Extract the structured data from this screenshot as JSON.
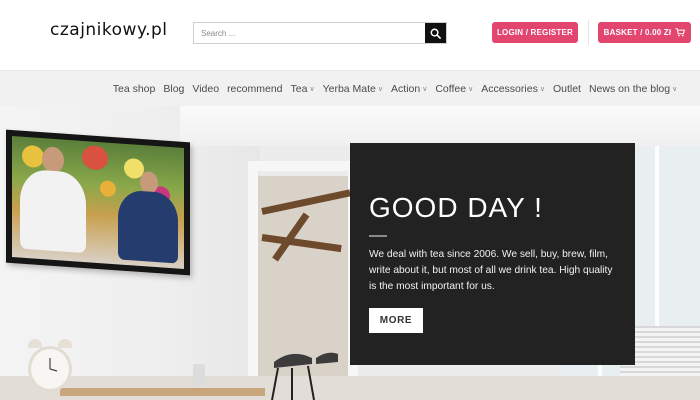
{
  "header": {
    "logo_text": "czajnikowy.pl",
    "search": {
      "placeholder": "Search ..."
    },
    "login_label": "LOGIN / REGISTER",
    "basket_label": "BASKET / 0.00 Zł"
  },
  "nav": {
    "items": [
      {
        "label": "Tea shop",
        "has_dropdown": false
      },
      {
        "label": "Blog",
        "has_dropdown": false
      },
      {
        "label": "Video",
        "has_dropdown": false
      },
      {
        "label": "recommend",
        "has_dropdown": false
      },
      {
        "label": "Tea",
        "has_dropdown": true
      },
      {
        "label": "Yerba Mate",
        "has_dropdown": true
      },
      {
        "label": "Action",
        "has_dropdown": true
      },
      {
        "label": "Coffee",
        "has_dropdown": true
      },
      {
        "label": "Accessories",
        "has_dropdown": true
      },
      {
        "label": "Outlet",
        "has_dropdown": false
      },
      {
        "label": "News on the blog",
        "has_dropdown": true
      }
    ]
  },
  "hero": {
    "title": "GOOD DAY !",
    "text": "We deal with tea since 2006. We sell, buy, brew, film, write about it, but most of all we drink tea. High quality is the most important for us.",
    "button_label": "MORE"
  },
  "colors": {
    "accent": "#e2466f",
    "overlay_bg": "#222222",
    "nav_bg": "#f1f1f1"
  },
  "icons": {
    "search": "search-icon",
    "cart": "cart-icon",
    "dropdown": "chevron-down-icon"
  }
}
